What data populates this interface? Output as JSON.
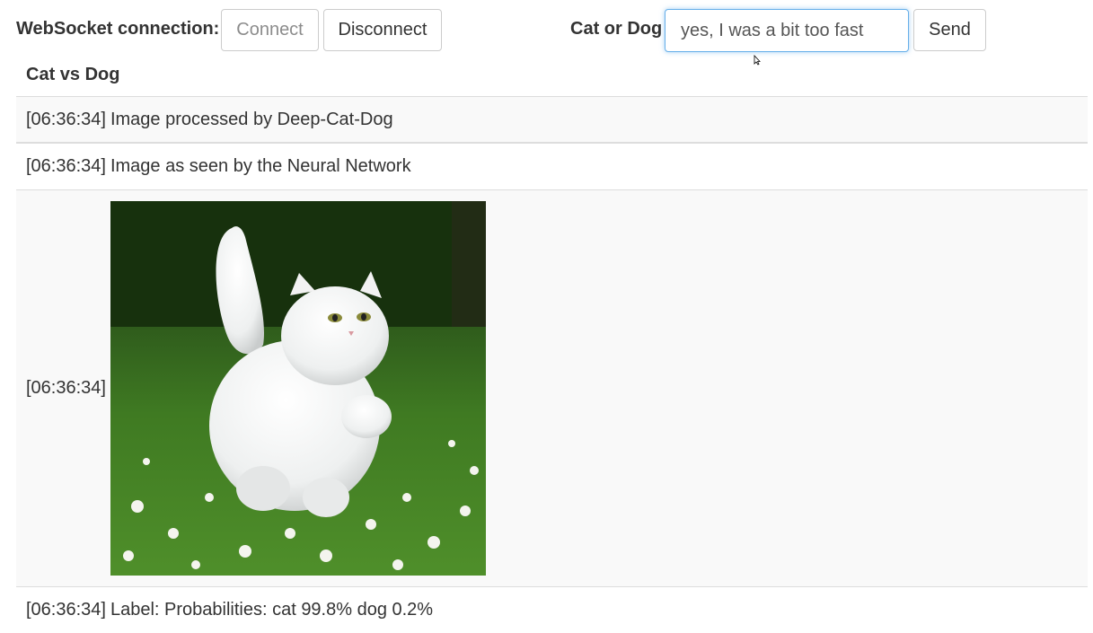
{
  "toolbar": {
    "ws_label": "WebSocket connection:",
    "connect_label": "Connect",
    "disconnect_label": "Disconnect",
    "cat_or_dog_label": "Cat or Dog",
    "message_value": "yes, I was a bit too fast",
    "send_label": "Send"
  },
  "log": {
    "header": "Cat vs Dog",
    "rows": [
      {
        "time": "[06:36:34]",
        "text": "Image processed by Deep-Cat-Dog"
      },
      {
        "time": "[06:36:34]",
        "text": "Image as seen by the Neural Network"
      },
      {
        "time": "[06:36:34]",
        "text": ""
      },
      {
        "time": "[06:36:34]",
        "text": "Label: Probabilities: cat 99.8% dog 0.2%"
      }
    ]
  },
  "colors": {
    "focus_border": "#66afe9",
    "border": "#cccccc",
    "stripe": "#f9f9f9",
    "text": "#333333"
  }
}
